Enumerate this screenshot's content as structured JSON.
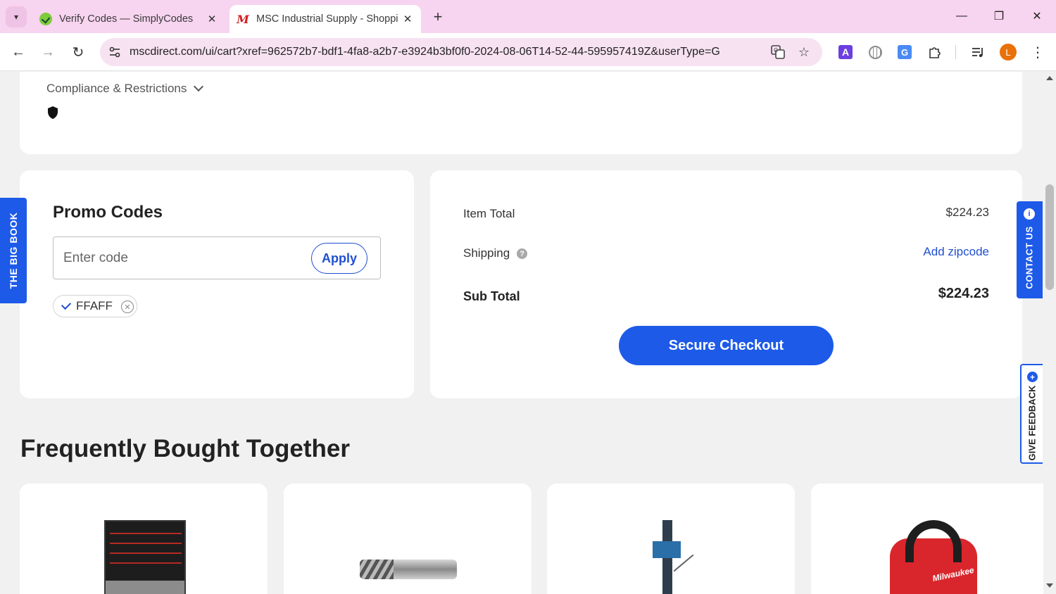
{
  "browser": {
    "tabs": [
      {
        "title": "Verify Codes — SimplyCodes",
        "icon": "simplycodes-favicon",
        "active": false
      },
      {
        "title": "MSC Industrial Supply - Shoppi",
        "icon": "msc-favicon",
        "active": true
      }
    ],
    "url": "mscdirect.com/ui/cart?xref=962572b7-bdf1-4fa8-a2b7-e3924b3bf0f0-2024-08-06T14-52-44-595957419Z&userType=G",
    "profile_initial": "L"
  },
  "compliance": {
    "label": "Compliance & Restrictions"
  },
  "promo": {
    "title": "Promo Codes",
    "placeholder": "Enter code",
    "apply_label": "Apply",
    "applied_code": "FFAFF"
  },
  "summary": {
    "item_total_label": "Item Total",
    "item_total_value": "$224.23",
    "shipping_label": "Shipping",
    "shipping_value": "Add zipcode",
    "subtotal_label": "Sub Total",
    "subtotal_value": "$224.23",
    "checkout_label": "Secure Checkout"
  },
  "fbt": {
    "title": "Frequently Bought Together"
  },
  "products": [
    {
      "icon": "tool-cabinet-image"
    },
    {
      "icon": "end-mill-image"
    },
    {
      "icon": "milling-machine-image"
    },
    {
      "icon": "milwaukee-fan-image",
      "brand": "Milwaukee"
    }
  ],
  "side_tabs": {
    "big_book": "THE BIG BOOK",
    "contact": "CONTACT US",
    "feedback": "GIVE FEEDBACK"
  },
  "colors": {
    "accent": "#1d5ae8",
    "tabbar": "#f7d4ef",
    "omnibox": "#f7e2f2",
    "msc_red": "#d31b21"
  }
}
